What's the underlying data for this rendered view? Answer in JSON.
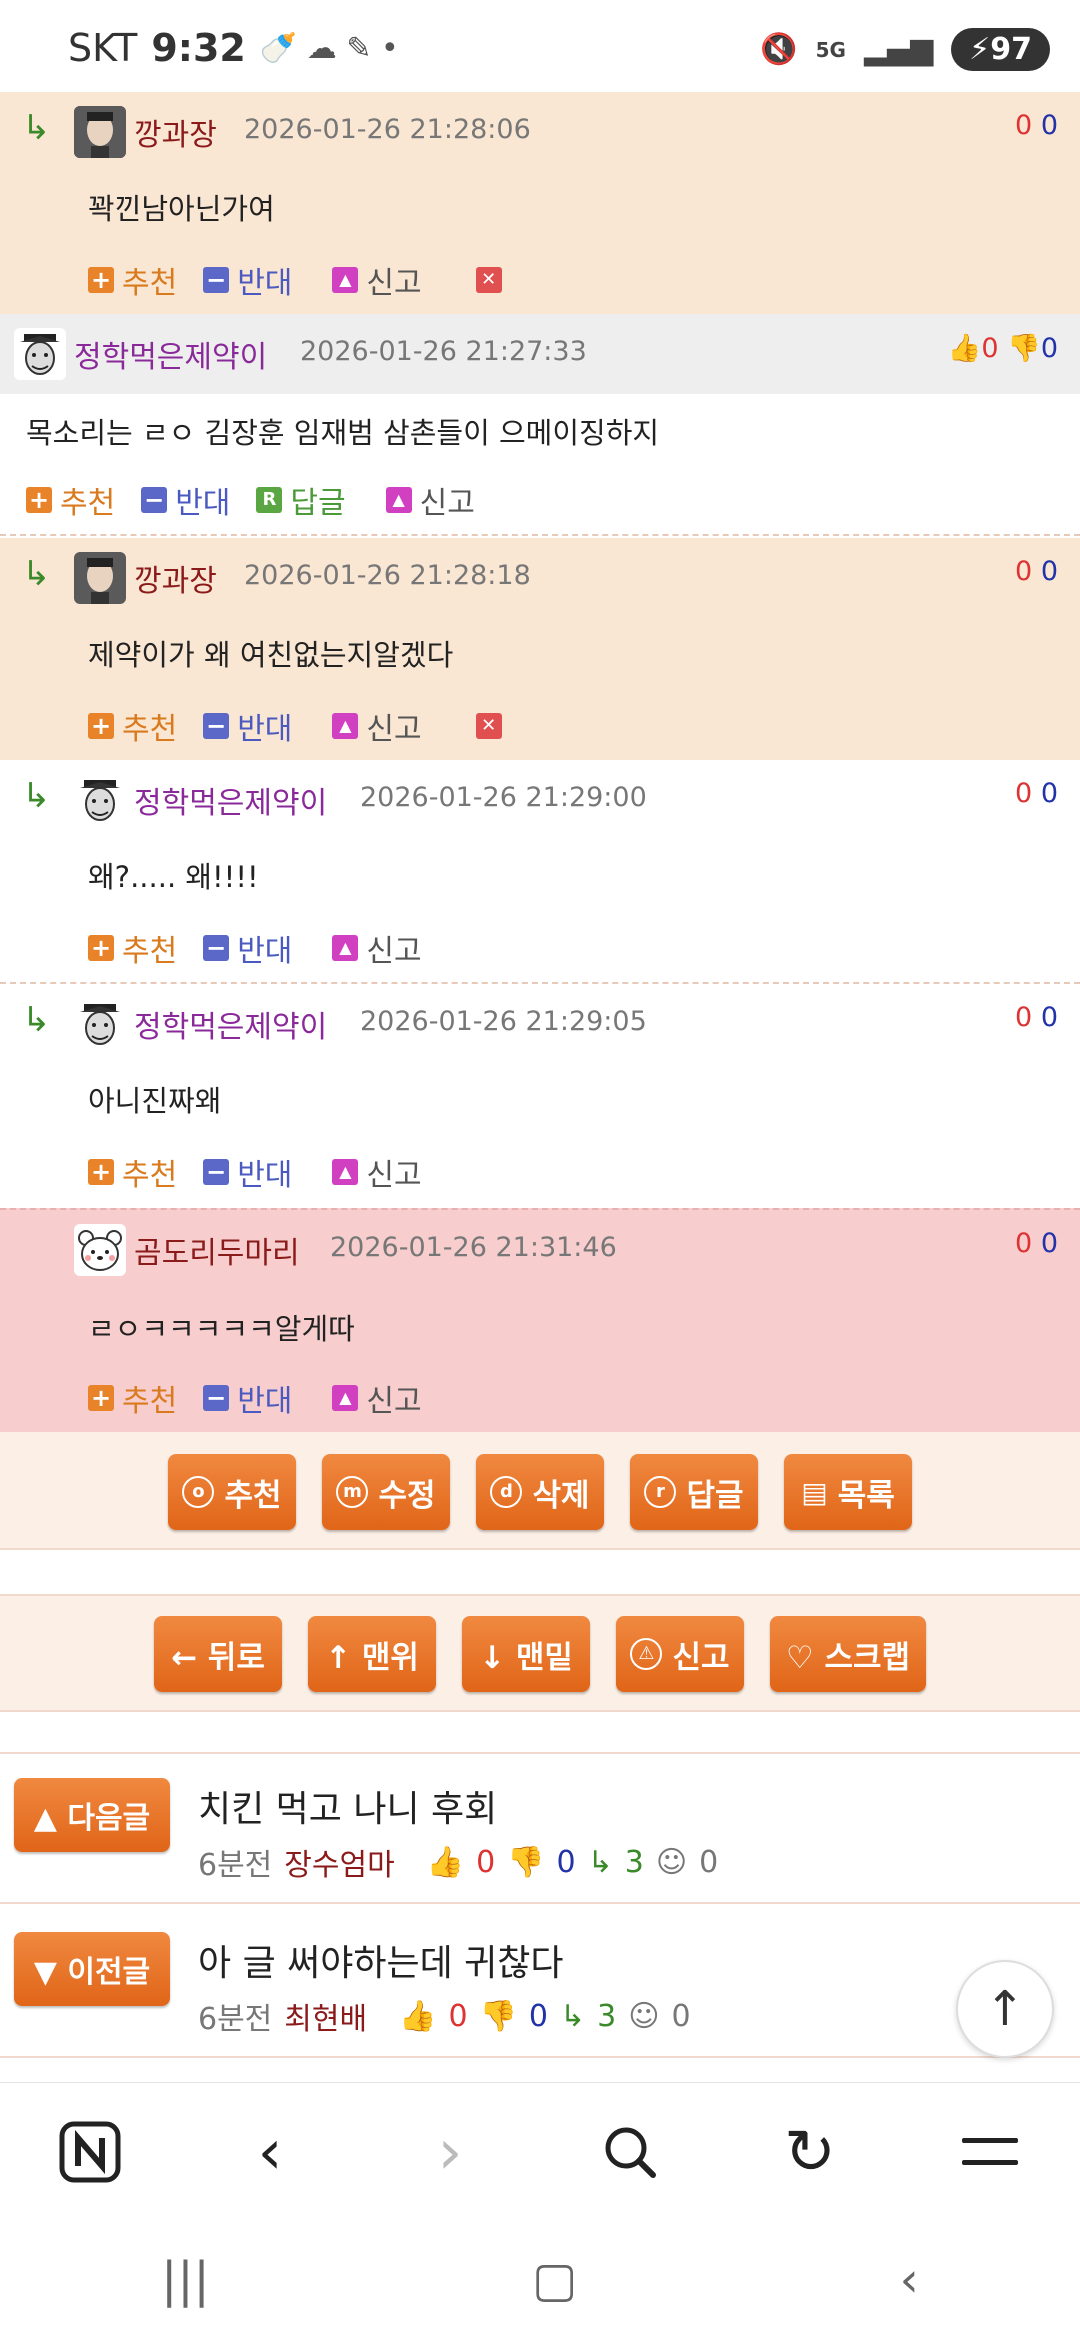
{
  "status_bar": {
    "carrier": "SKT",
    "time": "9:32",
    "battery": "97",
    "signal_label": "5G"
  },
  "comments": [
    {
      "author": "깡과장",
      "timestamp": "2026-01-26 21:28:06",
      "text": "꽉낀남아닌가여",
      "up": "0",
      "down": "0",
      "actions": {
        "recommend": "추천",
        "oppose": "반대",
        "report": "신고"
      }
    },
    {
      "author": "정학먹은제약이",
      "timestamp": "2026-01-26 21:27:33",
      "text": "목소리는 ㄹㅇ 김장훈 임재범 삼촌들이 으메이징하지",
      "up": "0",
      "down": "0",
      "actions": {
        "recommend": "추천",
        "oppose": "반대",
        "reply": "답글",
        "report": "신고"
      }
    },
    {
      "author": "깡과장",
      "timestamp": "2026-01-26 21:28:18",
      "text": "제약이가 왜 여친없는지알겠다",
      "up": "0",
      "down": "0",
      "actions": {
        "recommend": "추천",
        "oppose": "반대",
        "report": "신고"
      }
    },
    {
      "author": "정학먹은제약이",
      "timestamp": "2026-01-26 21:29:00",
      "text": "왜?..... 왜!!!!",
      "up": "0",
      "down": "0",
      "actions": {
        "recommend": "추천",
        "oppose": "반대",
        "report": "신고"
      }
    },
    {
      "author": "정학먹은제약이",
      "timestamp": "2026-01-26 21:29:05",
      "text": "아니진짜왜",
      "up": "0",
      "down": "0",
      "actions": {
        "recommend": "추천",
        "oppose": "반대",
        "report": "신고"
      }
    },
    {
      "author": "곰도리두마리",
      "timestamp": "2026-01-26 21:31:46",
      "text": "ㄹㅇㅋㅋㅋㅋㅋ알게따",
      "up": "0",
      "down": "0",
      "actions": {
        "recommend": "추천",
        "oppose": "반대",
        "report": "신고"
      }
    }
  ],
  "post_actions": {
    "recommend": "추천",
    "edit": "수정",
    "delete": "삭제",
    "reply": "답글",
    "list": "목록",
    "recommend_key": "o",
    "edit_key": "m",
    "delete_key": "d",
    "reply_key": "r"
  },
  "page_nav": {
    "back": "← 뒤로",
    "top": "↑ 맨위",
    "bottom": "↓ 맨밑",
    "report": "신고",
    "scrap": "♡ 스크랩"
  },
  "adjacent_posts": [
    {
      "button": "▲ 다음글",
      "title": "치킨 먹고 나니 후회",
      "time": "6분전",
      "author": "장수엄마",
      "up": "0",
      "down": "0",
      "replies": "3",
      "views": "0"
    },
    {
      "button": "▼ 이전글",
      "title": "아 글 써야하는데 귀찮다",
      "time": "6분전",
      "author": "최현배",
      "up": "0",
      "down": "0",
      "replies": "3",
      "views": "0"
    }
  ],
  "colors": {
    "reply_bg": "#f9e6d3",
    "gray_bg": "#eeeeee",
    "pink_bg": "#f7cdcd",
    "accent": "#e9742a"
  },
  "icons": [
    "naver-icon",
    "back-icon",
    "forward-icon",
    "search-icon",
    "refresh-icon",
    "menu-icon"
  ]
}
